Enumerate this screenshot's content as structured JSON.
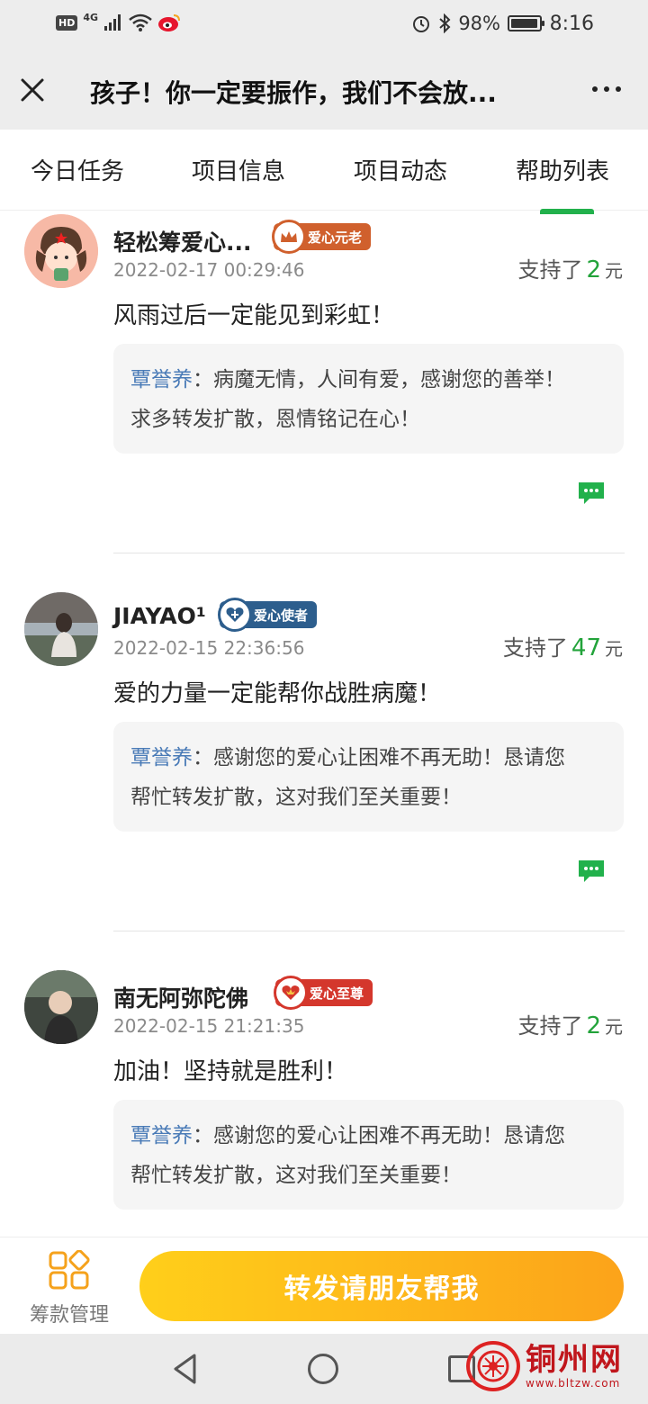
{
  "status_bar": {
    "hd": "HD",
    "network": "4G",
    "battery": "98%",
    "battery_level": 0.98,
    "time": "8:16"
  },
  "title_bar": {
    "title": "孩子！你一定要振作，我们不会放..."
  },
  "tabs": [
    {
      "label": "今日任务"
    },
    {
      "label": "项目信息"
    },
    {
      "label": "项目动态"
    },
    {
      "label": "帮助列表"
    }
  ],
  "comments": [
    {
      "name": "轻松筹爱心...",
      "badge": "爱心元老",
      "badge_color": "#d0602d",
      "time": "2022-02-17 00:29:46",
      "support_prefix": "支持了",
      "amount": "2",
      "unit": "元",
      "message": "风雨过后一定能见到彩虹！",
      "reply_name": "覃誉养",
      "reply_text_1": "病魔无情，人间有爱，感谢您的善举！",
      "reply_text_2": "求多转发扩散，恩情铭记在心！"
    },
    {
      "name": "JIAYAO¹",
      "badge": "爱心使者",
      "badge_color": "#2d5e8d",
      "time": "2022-02-15 22:36:56",
      "support_prefix": "支持了",
      "amount": "47",
      "unit": "元",
      "message": "爱的力量一定能帮你战胜病魔！",
      "reply_name": "覃誉养",
      "reply_text_1": "感谢您的爱心让困难不再无助！恳请您",
      "reply_text_2": "帮忙转发扩散，这对我们至关重要！"
    },
    {
      "name": "南无阿弥陀佛",
      "badge": "爱心至尊",
      "badge_color": "#d4372c",
      "time": "2022-02-15 21:21:35",
      "support_prefix": "支持了",
      "amount": "2",
      "unit": "元",
      "message": "加油！坚持就是胜利！",
      "reply_name": "覃誉养",
      "reply_text_1": "感谢您的爱心让困难不再无助！恳请您",
      "reply_text_2": "帮忙转发扩散，这对我们至关重要！"
    }
  ],
  "reply_separator": "：",
  "action_bar": {
    "manage_label": "筹款管理",
    "share_label": "转发请朋友帮我"
  },
  "watermark": {
    "title": "铜州网",
    "url": "www.bltzw.com"
  },
  "colors": {
    "accent_green": "#22a33a",
    "reply_name": "#4a7bb7",
    "share_start": "#ffcf1a",
    "share_end": "#fca31a",
    "watermark_red": "#c0161c"
  }
}
